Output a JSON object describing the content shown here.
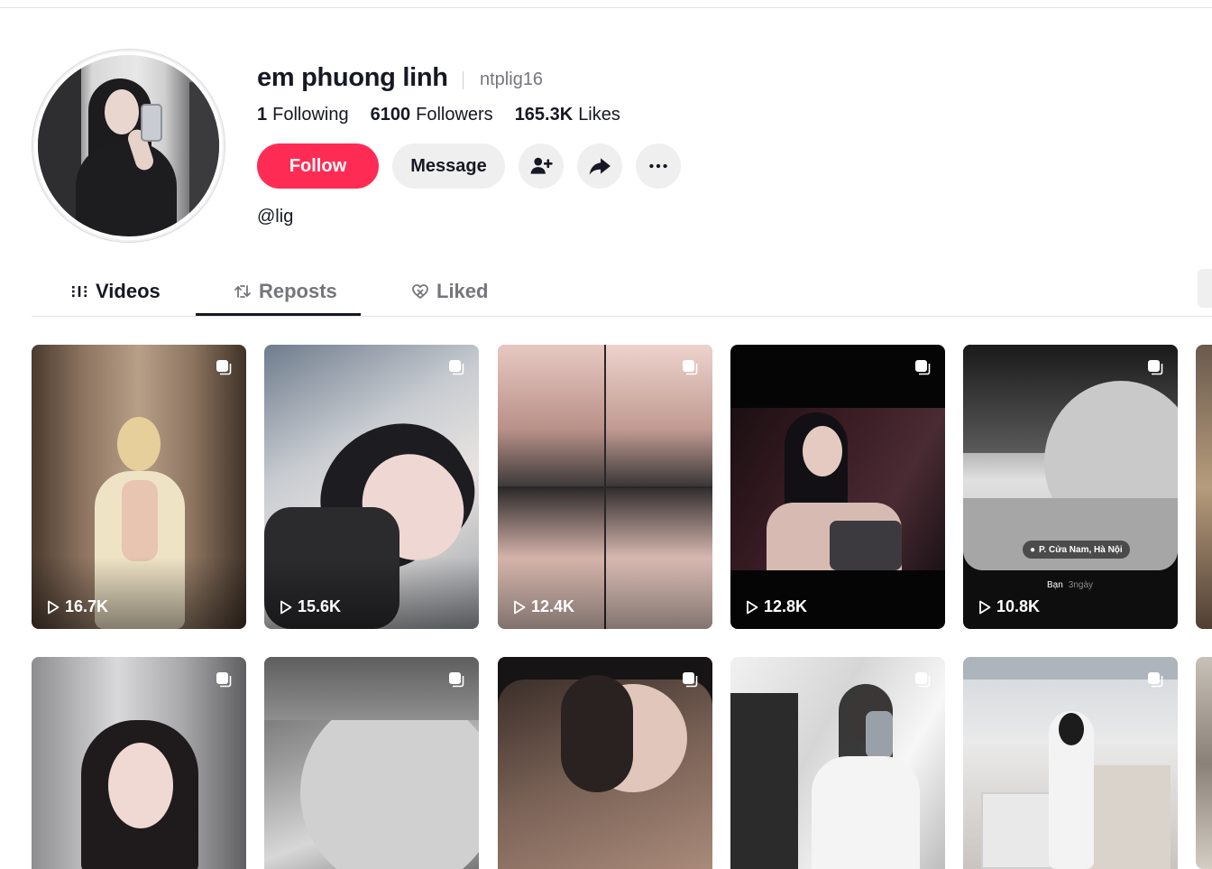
{
  "profile": {
    "display_name": "em phuong linh",
    "username": "ntplig16",
    "bio": "@lig",
    "stats": [
      {
        "value": "1",
        "label": "Following"
      },
      {
        "value": "6100",
        "label": "Followers"
      },
      {
        "value": "165.3K",
        "label": "Likes"
      }
    ]
  },
  "actions": {
    "follow_label": "Follow",
    "message_label": "Message",
    "add_friend_icon": "add-user-icon",
    "share_icon": "share-icon",
    "more_icon": "more-icon"
  },
  "tabs": [
    {
      "label": "Videos",
      "icon": "grid-icon",
      "active": true
    },
    {
      "label": "Reposts",
      "icon": "repost-icon",
      "active": false
    },
    {
      "label": "Liked",
      "icon": "heart-icon",
      "active": false
    }
  ],
  "videos": [
    {
      "views": "16.7K"
    },
    {
      "views": "15.6K"
    },
    {
      "views": "12.4K"
    },
    {
      "views": "12.8K"
    },
    {
      "views": "10.8K",
      "location": "P. Cửa Nam, Hà Nội",
      "meta_name": "Bạn",
      "meta_time": "3ngày"
    },
    {
      "views": ""
    },
    {
      "views": ""
    },
    {
      "views": ""
    },
    {
      "views": ""
    },
    {
      "views": ""
    }
  ],
  "colors": {
    "accent": "#fe2c55",
    "text": "#161823",
    "muted": "#75767c",
    "button_bg": "#efeff0"
  }
}
